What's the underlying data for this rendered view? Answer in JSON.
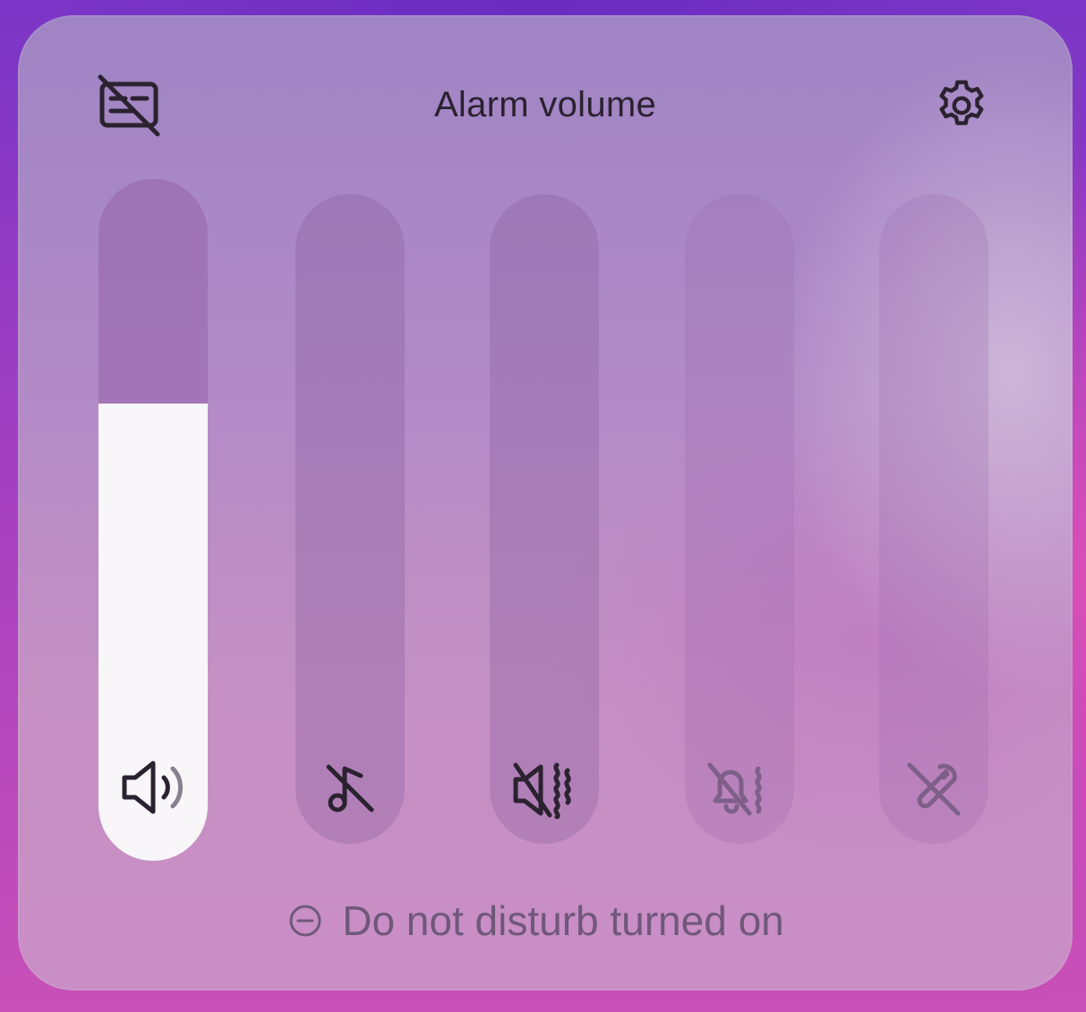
{
  "panel": {
    "title": "Alarm volume",
    "left_icon": "caption-off-icon",
    "settings_icon": "gear-icon"
  },
  "sliders": [
    {
      "name": "media",
      "icon": "speaker-volume-icon",
      "level": 0.67,
      "state": "active"
    },
    {
      "name": "music",
      "icon": "music-off-icon",
      "level": 0,
      "state": "muted"
    },
    {
      "name": "ring",
      "icon": "speaker-mute-vibrate-icon",
      "level": 0,
      "state": "muted"
    },
    {
      "name": "notification",
      "icon": "bell-off-vibrate-icon",
      "level": 0,
      "state": "disabled"
    },
    {
      "name": "system",
      "icon": "tools-off-icon",
      "level": 0,
      "state": "disabled"
    }
  ],
  "footer": {
    "dnd_icon": "minus-circle-icon",
    "dnd_text": "Do not disturb turned on"
  },
  "colors": {
    "slider_fill": "#f8f6f8",
    "icon_dark": "#2b2230",
    "icon_faded": "#7d5f88",
    "footer_text": "#70587a"
  }
}
